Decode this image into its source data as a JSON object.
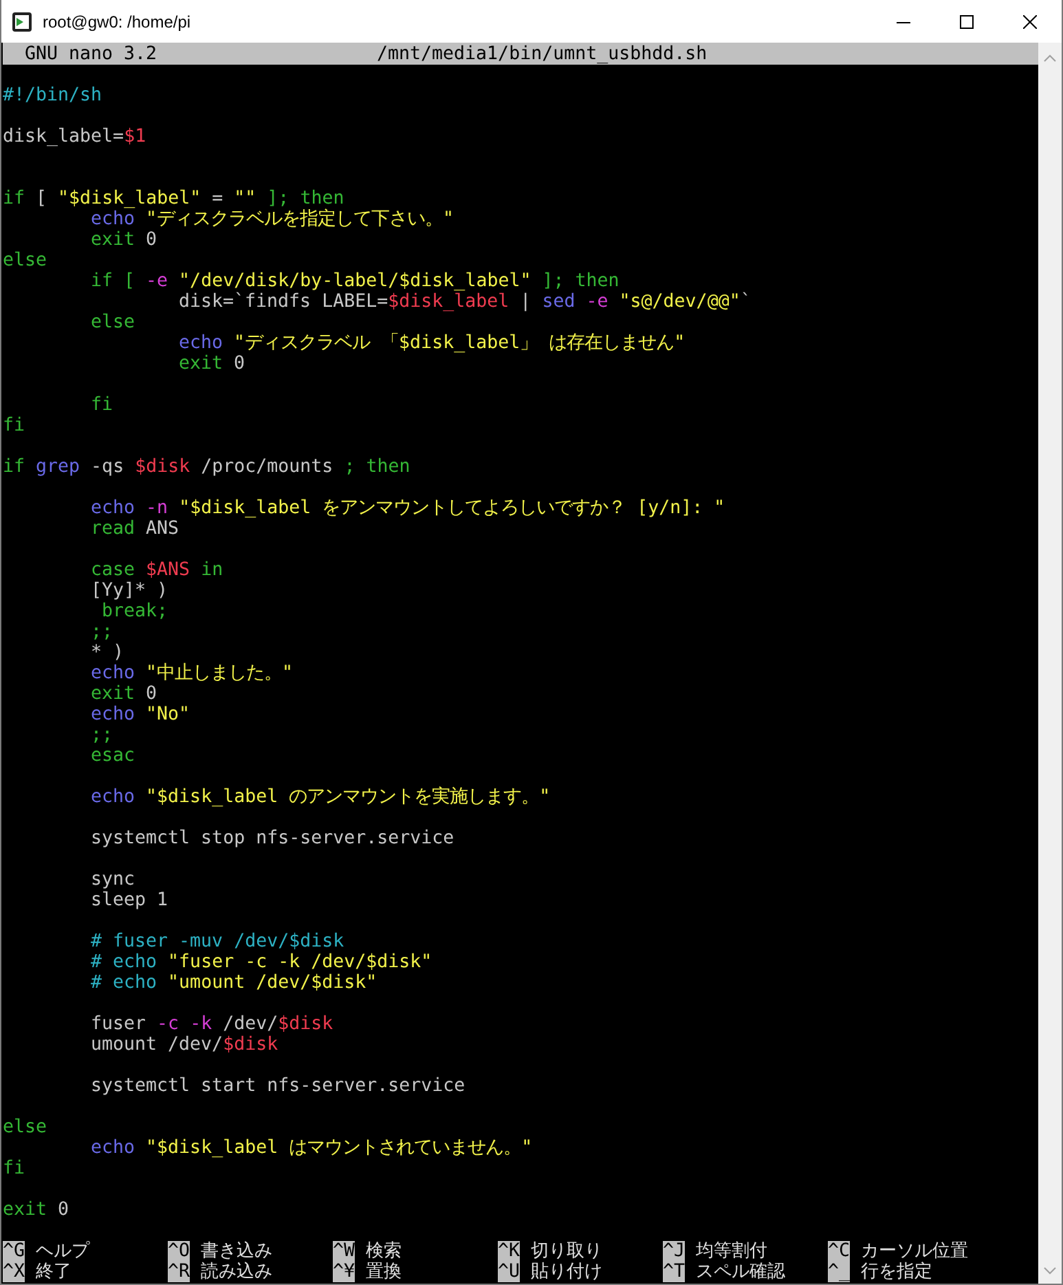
{
  "window": {
    "title": "root@gw0: /home/pi"
  },
  "header": {
    "program": "GNU nano 3.2",
    "file": "/mnt/media1/bin/umnt_usbhdd.sh"
  },
  "lines": [
    {
      "kind": "top",
      "segments": [
        {
          "kind": "comment",
          "text": "#!/bin/sh"
        }
      ]
    },
    {
      "kind": "blank"
    },
    {
      "kind": "top",
      "segments": [
        {
          "kind": "plain",
          "text": "disk_label="
        },
        {
          "kind": "var",
          "text": "$1"
        }
      ]
    },
    {
      "kind": "blank"
    },
    {
      "kind": "blank"
    },
    {
      "kind": "top",
      "segments": [
        {
          "kind": "keyword",
          "text": "if"
        },
        {
          "kind": "plain",
          "text": " [ "
        },
        {
          "kind": "string",
          "text": "\"$disk_label\""
        },
        {
          "kind": "plain",
          "text": " = "
        },
        {
          "kind": "string",
          "text": "\"\""
        },
        {
          "kind": "keyword",
          "text": " ]; then"
        }
      ]
    },
    {
      "kind": "nested",
      "segments": [
        {
          "kind": "builtin",
          "text": "echo"
        },
        {
          "kind": "string",
          "text": " \"ディスクラベルを指定して下さい。\""
        }
      ]
    },
    {
      "kind": "nested",
      "segments": [
        {
          "kind": "keyword",
          "text": "exit"
        },
        {
          "kind": "plain",
          "text": " 0"
        }
      ]
    },
    {
      "kind": "top",
      "segments": [
        {
          "kind": "keyword",
          "text": "else"
        }
      ]
    },
    {
      "kind": "nested",
      "segments": [
        {
          "kind": "keyword",
          "text": "if [ "
        },
        {
          "kind": "option",
          "text": "-e"
        },
        {
          "kind": "string",
          "text": " \"/dev/disk/by-label/$disk_label\""
        },
        {
          "kind": "keyword",
          "text": " ]; then"
        }
      ]
    },
    {
      "kind": "deep",
      "segments": [
        {
          "kind": "plain",
          "text": "disk=`findfs LABEL="
        },
        {
          "kind": "var",
          "text": "$disk_label"
        },
        {
          "kind": "plain",
          "text": " | "
        },
        {
          "kind": "builtin",
          "text": "sed"
        },
        {
          "kind": "option",
          "text": " -e"
        },
        {
          "kind": "string",
          "text": " \"s@/dev/@@\""
        },
        {
          "kind": "plain",
          "text": "`"
        }
      ]
    },
    {
      "kind": "nested",
      "segments": [
        {
          "kind": "keyword",
          "text": "else"
        }
      ]
    },
    {
      "kind": "deep",
      "segments": [
        {
          "kind": "builtin",
          "text": "echo"
        },
        {
          "kind": "string",
          "text": " \"ディスクラベル 「$disk_label」 は存在しません\""
        }
      ]
    },
    {
      "kind": "deep",
      "segments": [
        {
          "kind": "keyword",
          "text": "exit"
        },
        {
          "kind": "plain",
          "text": " 0"
        }
      ]
    },
    {
      "kind": "blank"
    },
    {
      "kind": "nested",
      "segments": [
        {
          "kind": "keyword",
          "text": "fi"
        }
      ]
    },
    {
      "kind": "top",
      "segments": [
        {
          "kind": "keyword",
          "text": "fi"
        }
      ]
    },
    {
      "kind": "blank"
    },
    {
      "kind": "top",
      "segments": [
        {
          "kind": "keyword",
          "text": "if"
        },
        {
          "kind": "builtin",
          "text": " grep"
        },
        {
          "kind": "plain",
          "text": " -qs "
        },
        {
          "kind": "var",
          "text": "$disk"
        },
        {
          "kind": "plain",
          "text": " /proc/mounts "
        },
        {
          "kind": "keyword",
          "text": "; then"
        }
      ]
    },
    {
      "kind": "blank"
    },
    {
      "kind": "nested",
      "segments": [
        {
          "kind": "builtin",
          "text": "echo"
        },
        {
          "kind": "option",
          "text": " -n"
        },
        {
          "kind": "string",
          "text": " \"$disk_label をアンマウントしてよろしいですか？ [y/n]: \""
        }
      ]
    },
    {
      "kind": "nested",
      "segments": [
        {
          "kind": "keyword",
          "text": "read"
        },
        {
          "kind": "plain",
          "text": " ANS"
        }
      ]
    },
    {
      "kind": "blank"
    },
    {
      "kind": "nested",
      "segments": [
        {
          "kind": "keyword",
          "text": "case"
        },
        {
          "kind": "var",
          "text": " $ANS"
        },
        {
          "kind": "keyword",
          "text": " in"
        }
      ]
    },
    {
      "kind": "nested",
      "segments": [
        {
          "kind": "plain",
          "text": "[Yy]* )"
        }
      ]
    },
    {
      "kind": "nested",
      "segments": [
        {
          "kind": "keyword",
          "text": " break;"
        }
      ]
    },
    {
      "kind": "nested",
      "segments": [
        {
          "kind": "keyword",
          "text": ";;"
        }
      ]
    },
    {
      "kind": "nested",
      "segments": [
        {
          "kind": "plain",
          "text": "* )"
        }
      ]
    },
    {
      "kind": "nested",
      "segments": [
        {
          "kind": "builtin",
          "text": "echo"
        },
        {
          "kind": "string",
          "text": " \"中止しました。\""
        }
      ]
    },
    {
      "kind": "nested",
      "segments": [
        {
          "kind": "keyword",
          "text": "exit"
        },
        {
          "kind": "plain",
          "text": " 0"
        }
      ]
    },
    {
      "kind": "nested",
      "segments": [
        {
          "kind": "builtin",
          "text": "echo"
        },
        {
          "kind": "string",
          "text": " \"No\""
        }
      ]
    },
    {
      "kind": "nested",
      "segments": [
        {
          "kind": "keyword",
          "text": ";;"
        }
      ]
    },
    {
      "kind": "nested",
      "segments": [
        {
          "kind": "keyword",
          "text": "esac"
        }
      ]
    },
    {
      "kind": "blank"
    },
    {
      "kind": "nested",
      "segments": [
        {
          "kind": "builtin",
          "text": "echo"
        },
        {
          "kind": "string",
          "text": " \"$disk_label のアンマウントを実施します。\""
        }
      ]
    },
    {
      "kind": "blank"
    },
    {
      "kind": "nested",
      "segments": [
        {
          "kind": "plain",
          "text": "systemctl stop nfs-server.service"
        }
      ]
    },
    {
      "kind": "blank"
    },
    {
      "kind": "nested",
      "segments": [
        {
          "kind": "plain",
          "text": "sync"
        }
      ]
    },
    {
      "kind": "nested",
      "segments": [
        {
          "kind": "plain",
          "text": "sleep 1"
        }
      ]
    },
    {
      "kind": "blank"
    },
    {
      "kind": "nested",
      "segments": [
        {
          "kind": "comment",
          "text": "# fuser -muv /dev/$disk"
        }
      ]
    },
    {
      "kind": "nested",
      "segments": [
        {
          "kind": "comment",
          "text": "# echo "
        },
        {
          "kind": "string",
          "text": "\"fuser -c -k /dev/$disk\""
        }
      ]
    },
    {
      "kind": "nested",
      "segments": [
        {
          "kind": "comment",
          "text": "# echo "
        },
        {
          "kind": "string",
          "text": "\"umount /dev/$disk\""
        }
      ]
    },
    {
      "kind": "blank"
    },
    {
      "kind": "nested",
      "segments": [
        {
          "kind": "plain",
          "text": "fuser "
        },
        {
          "kind": "option",
          "text": "-c -k"
        },
        {
          "kind": "plain",
          "text": " /dev/"
        },
        {
          "kind": "var",
          "text": "$disk"
        }
      ]
    },
    {
      "kind": "nested",
      "segments": [
        {
          "kind": "plain",
          "text": "umount /dev/"
        },
        {
          "kind": "var",
          "text": "$disk"
        }
      ]
    },
    {
      "kind": "blank"
    },
    {
      "kind": "nested",
      "segments": [
        {
          "kind": "plain",
          "text": "systemctl start nfs-server.service"
        }
      ]
    },
    {
      "kind": "blank"
    },
    {
      "kind": "top",
      "segments": [
        {
          "kind": "keyword",
          "text": "else"
        }
      ]
    },
    {
      "kind": "nested",
      "segments": [
        {
          "kind": "builtin",
          "text": "echo"
        },
        {
          "kind": "string",
          "text": " \"$disk_label はマウントされていません。\""
        }
      ]
    },
    {
      "kind": "top",
      "segments": [
        {
          "kind": "keyword",
          "text": "fi"
        }
      ]
    },
    {
      "kind": "blank"
    },
    {
      "kind": "top",
      "segments": [
        {
          "kind": "keyword",
          "text": "exit"
        },
        {
          "kind": "plain",
          "text": " 0"
        }
      ]
    }
  ],
  "shortcuts": [
    {
      "key": "^G",
      "label": "ヘルプ"
    },
    {
      "key": "^X",
      "label": "終了"
    },
    {
      "key": "^O",
      "label": "書き込み"
    },
    {
      "key": "^R",
      "label": "読み込み"
    },
    {
      "key": "^W",
      "label": "検索"
    },
    {
      "key": "^¥",
      "label": "置換"
    },
    {
      "key": "^K",
      "label": "切り取り"
    },
    {
      "key": "^U",
      "label": "貼り付け"
    },
    {
      "key": "^J",
      "label": "均等割付"
    },
    {
      "key": "^T",
      "label": "スペル確認"
    },
    {
      "key": "^C",
      "label": "カーソル位置"
    },
    {
      "key": "^_",
      "label": "行を指定"
    }
  ]
}
